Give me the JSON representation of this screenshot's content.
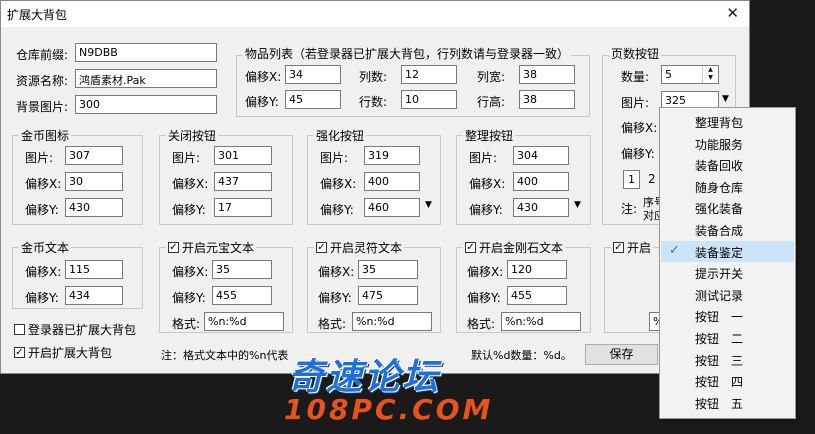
{
  "window": {
    "title": "扩展大背包",
    "close": "✕"
  },
  "top": {
    "prefix_label": "仓库前缀:",
    "prefix_value": "N9DBB",
    "res_label": "资源名称:",
    "res_value": "鸿盾素材.Pak",
    "bg_label": "背景图片:",
    "bg_value": "300"
  },
  "items": {
    "title": "物品列表（若登录器已扩展大背包，行列数请与登录器一致）",
    "offx_label": "偏移X:",
    "offx": "34",
    "offy_label": "偏移Y:",
    "offy": "45",
    "cols_label": "列数:",
    "cols": "12",
    "rows_label": "行数:",
    "rows": "10",
    "colw_label": "列宽:",
    "colw": "38",
    "rowh_label": "行高:",
    "rowh": "38"
  },
  "page": {
    "title": "页数按钮",
    "count_label": "数量:",
    "count": "5",
    "img_label": "图片:",
    "img": "325",
    "offx_label": "偏移X:",
    "offy_label": "偏移Y:",
    "nums": [
      "1",
      "2"
    ],
    "note": "注:",
    "note2": "序号",
    "note3": "对应"
  },
  "gold": {
    "title": "金币图标",
    "img_label": "图片:",
    "img": "307",
    "offx_label": "偏移X:",
    "offx": "30",
    "offy_label": "偏移Y:",
    "offy": "430"
  },
  "close_btn": {
    "title": "关闭按钮",
    "img_label": "图片:",
    "img": "301",
    "offx_label": "偏移X:",
    "offx": "437",
    "offy_label": "偏移Y:",
    "offy": "17"
  },
  "strengthen": {
    "title": "强化按钮",
    "img_label": "图片:",
    "img": "319",
    "offx_label": "偏移X:",
    "offx": "400",
    "offy_label": "偏移Y:",
    "offy": "460"
  },
  "sort": {
    "title": "整理按钮",
    "img_label": "图片:",
    "img": "304",
    "offx_label": "偏移X:",
    "offx": "400",
    "offy_label": "偏移Y:",
    "offy": "430"
  },
  "gold_text": {
    "title": "金币文本",
    "offx_label": "偏移X:",
    "offx": "115",
    "offy_label": "偏移Y:",
    "offy": "434"
  },
  "yuanbao": {
    "title": "开启元宝文本",
    "offx_label": "偏移X:",
    "offx": "35",
    "offy_label": "偏移Y:",
    "offy": "455",
    "fmt_label": "格式:",
    "fmt": "%n:%d"
  },
  "lingfu": {
    "title": "开启灵符文本",
    "offx_label": "偏移X:",
    "offx": "35",
    "offy_label": "偏移Y:",
    "offy": "475",
    "fmt_label": "格式:",
    "fmt": "%n:%d"
  },
  "jingang": {
    "title": "开启金刚石文本",
    "offx_label": "偏移X:",
    "offx": "120",
    "offy_label": "偏移Y:",
    "offy": "455",
    "fmt_label": "格式:",
    "fmt": "%n:%d"
  },
  "fifth": {
    "title": "开启",
    "fmt": "%"
  },
  "checks": {
    "extended": "登录器已扩展大背包",
    "enable": "开启扩展大背包"
  },
  "note": "注：格式文本中的%n代表",
  "note_tail": "默认%d数量：%d。",
  "save": "保存",
  "menu": {
    "items": [
      "整理背包",
      "功能服务",
      "装备回收",
      "随身仓库",
      "强化装备",
      "装备合成",
      "装备鉴定",
      "提示开关",
      "测试记录",
      "按钮　一",
      "按钮　二",
      "按钮　三",
      "按钮　四",
      "按钮　五"
    ],
    "selected_index": 6
  },
  "watermark": {
    "line1": "奇速论坛",
    "line2": "108PC.COM"
  }
}
